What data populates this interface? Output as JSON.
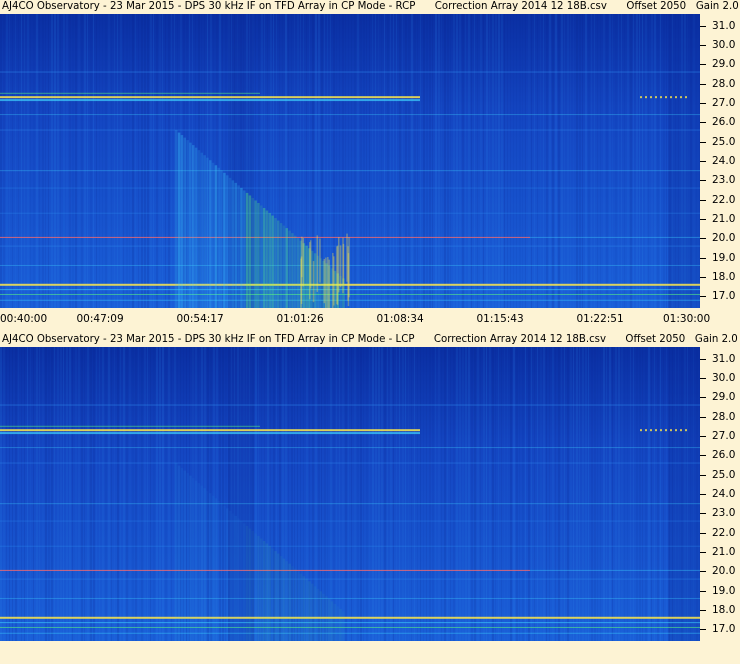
{
  "chart_data": [
    {
      "type": "heatmap",
      "title": "AJ4CO Observatory - 23 Mar 2015 - DPS 30 kHz IF on TFD Array in CP Mode - RCP      Correction Array 2014 12 18B.csv      Offset 2050   Gain 2.0",
      "y_ticks": [
        "31.0",
        "30.0",
        "29.0",
        "28.0",
        "27.0",
        "26.0",
        "25.0",
        "24.0",
        "23.0",
        "22.0",
        "21.0",
        "20.0",
        "19.0",
        "18.0",
        "17.0"
      ],
      "x_ticks": [
        "00:40:00",
        "00:47:09",
        "00:54:17",
        "01:01:26",
        "01:08:34",
        "01:15:43",
        "01:22:51",
        "01:30:00"
      ],
      "ylim": [
        16.4,
        31.6
      ]
    },
    {
      "type": "heatmap",
      "title": "AJ4CO Observatory - 23 Mar 2015 - DPS 30 kHz IF on TFD Array in CP Mode - LCP      Correction Array 2014 12 18B.csv      Offset 2050   Gain 2.0",
      "y_ticks": [
        "31.0",
        "30.0",
        "29.0",
        "28.0",
        "27.0",
        "26.0",
        "25.0",
        "24.0",
        "23.0",
        "22.0",
        "21.0",
        "20.0",
        "19.0",
        "18.0",
        "17.0"
      ],
      "x_ticks": [],
      "ylim": [
        16.4,
        31.6
      ]
    }
  ],
  "colors": {
    "deep": "#0a2fa3",
    "mid": "#1a5fd8",
    "bright": "#2f8cf0",
    "cyan": "#3fd2ff",
    "green": "#5cff7a",
    "yellow": "#ffe94a",
    "red": "#ff6a6a",
    "background": "#fdf3d4"
  }
}
